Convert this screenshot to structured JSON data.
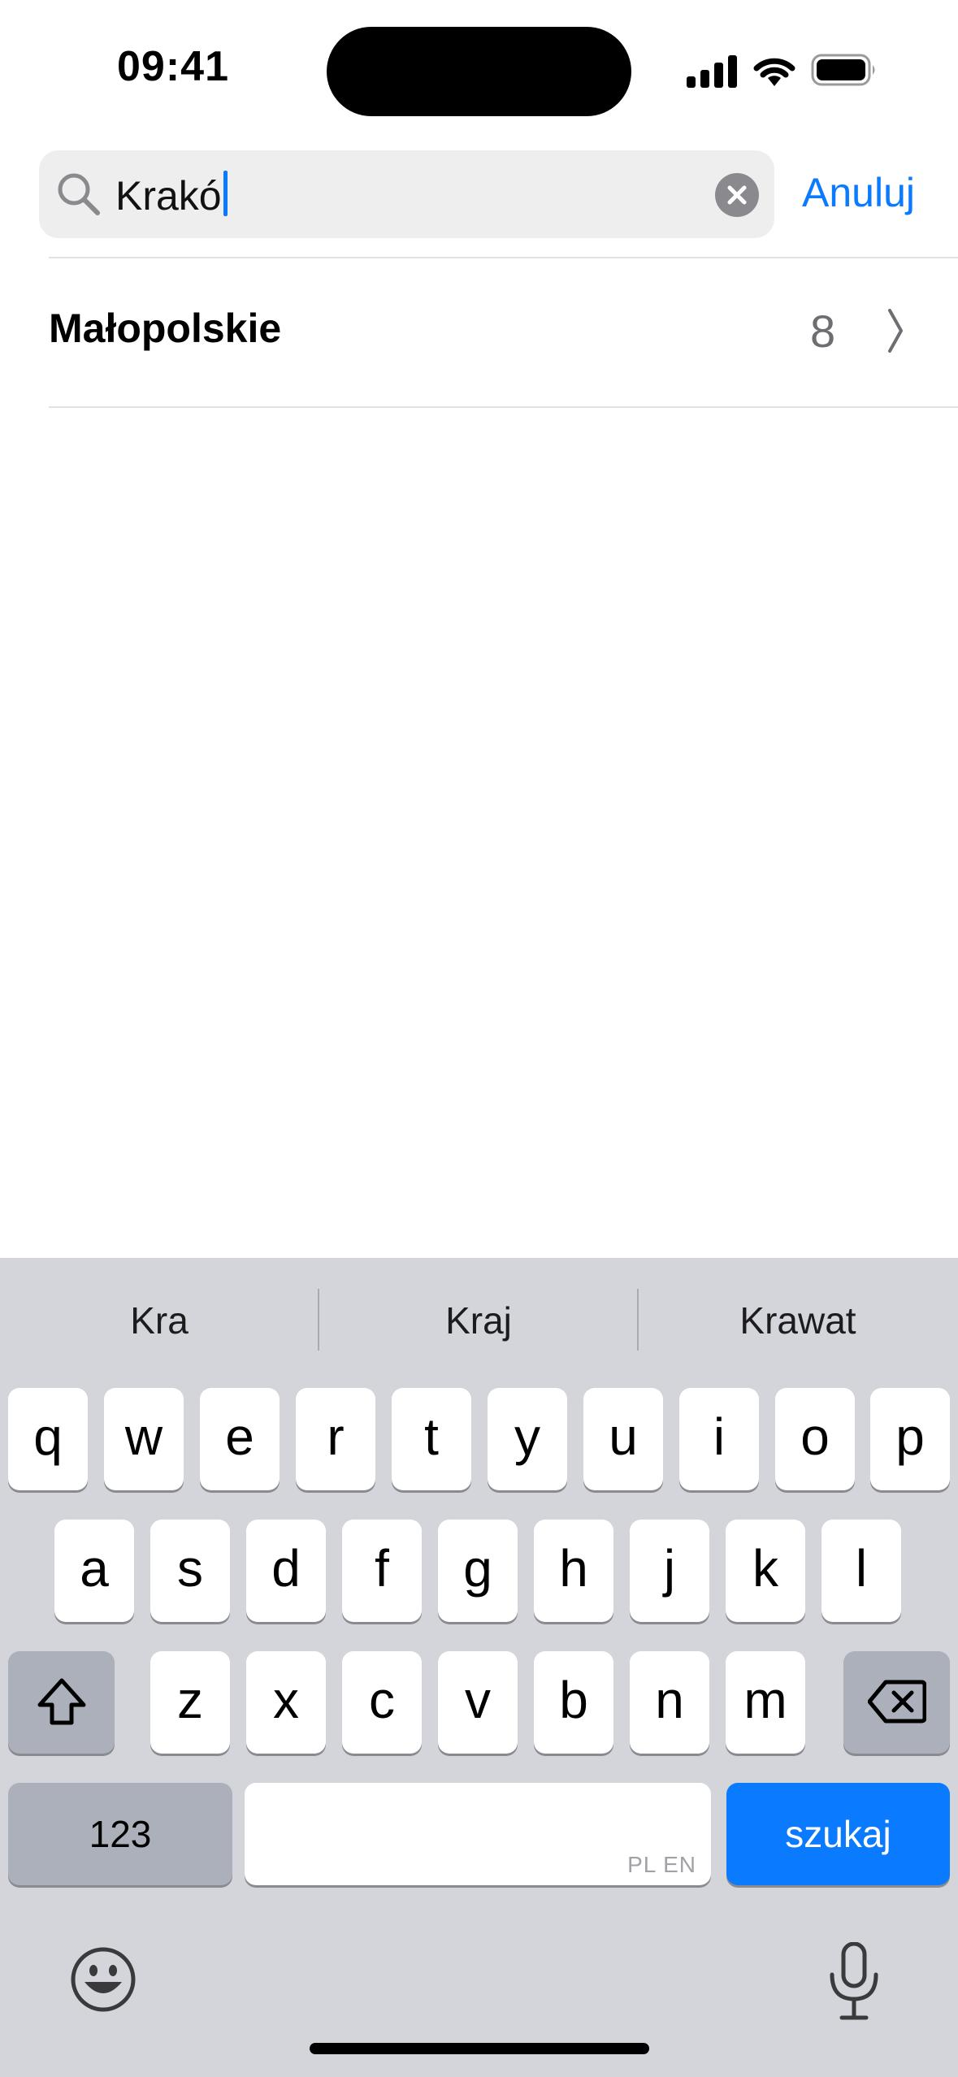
{
  "status_bar": {
    "time": "09:41",
    "icons": [
      "signal-icon",
      "wifi-icon",
      "battery-icon"
    ]
  },
  "search": {
    "value": "Krakó",
    "clear_icon": "clear-circle-icon",
    "cancel_label": "Anuluj"
  },
  "results": [
    {
      "label": "Małopolskie",
      "count": "8",
      "icon": "chevron-right-icon"
    }
  ],
  "keyboard": {
    "suggestions": [
      "Kra",
      "Kraj",
      "Krawat"
    ],
    "row1": [
      "q",
      "w",
      "e",
      "r",
      "t",
      "y",
      "u",
      "i",
      "o",
      "p"
    ],
    "row2": [
      "a",
      "s",
      "d",
      "f",
      "g",
      "h",
      "j",
      "k",
      "l"
    ],
    "row3": [
      "z",
      "x",
      "c",
      "v",
      "b",
      "n",
      "m"
    ],
    "numbers_label": "123",
    "space_language_hint": "PL EN",
    "search_label": "szukaj",
    "icons": [
      "shift-icon",
      "delete-icon",
      "emoji-icon",
      "microphone-icon"
    ]
  },
  "colors": {
    "accent": "#0a7aff",
    "keyboard_bg": "#d3d5db",
    "search_field_bg": "#eeeeef"
  }
}
